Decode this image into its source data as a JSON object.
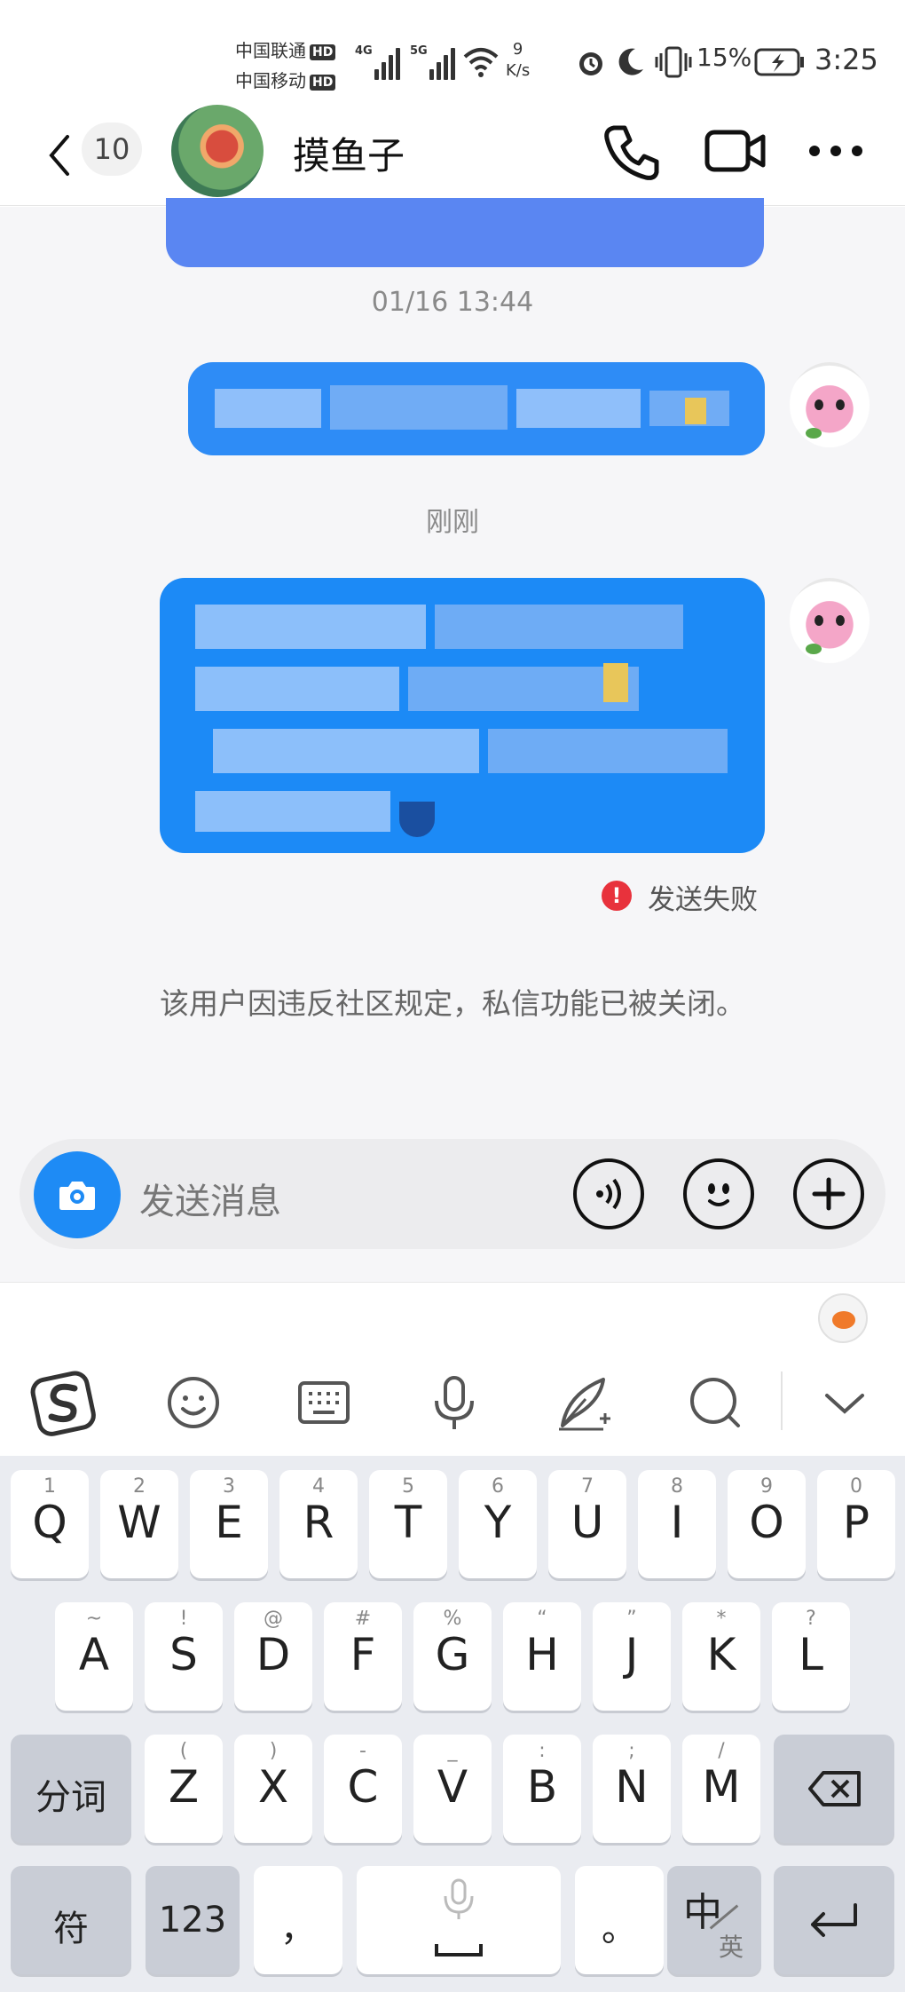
{
  "status_bar": {
    "carrier_1": "中国联通",
    "carrier_2": "中国移动",
    "hd_badge": "HD",
    "net_1": "4G",
    "net_2": "5G",
    "speed_value": "9",
    "speed_unit": "K/s",
    "battery": "15%",
    "time": "3:25"
  },
  "header": {
    "unread_count": "10",
    "contact_name": "摸鱼子"
  },
  "chat": {
    "timestamp_1": "01/16 13:44",
    "timestamp_2": "刚刚",
    "send_failed": "发送失败",
    "fail_icon": "!",
    "notice": "该用户因违反社区规定，私信功能已被关闭。"
  },
  "composer": {
    "placeholder": "发送消息"
  },
  "keyboard": {
    "row1": [
      {
        "key": "Q",
        "num": "1"
      },
      {
        "key": "W",
        "num": "2"
      },
      {
        "key": "E",
        "num": "3"
      },
      {
        "key": "R",
        "num": "4"
      },
      {
        "key": "T",
        "num": "5"
      },
      {
        "key": "Y",
        "num": "6"
      },
      {
        "key": "U",
        "num": "7"
      },
      {
        "key": "I",
        "num": "8"
      },
      {
        "key": "O",
        "num": "9"
      },
      {
        "key": "P",
        "num": "0"
      }
    ],
    "row2": [
      {
        "key": "A",
        "sym": "~"
      },
      {
        "key": "S",
        "sym": "!"
      },
      {
        "key": "D",
        "sym": "@"
      },
      {
        "key": "F",
        "sym": "#"
      },
      {
        "key": "G",
        "sym": "%"
      },
      {
        "key": "H",
        "sym": "“"
      },
      {
        "key": "J",
        "sym": "”"
      },
      {
        "key": "K",
        "sym": "*"
      },
      {
        "key": "L",
        "sym": "?"
      }
    ],
    "row3": [
      {
        "key": "Z",
        "sym": "("
      },
      {
        "key": "X",
        "sym": ")"
      },
      {
        "key": "C",
        "sym": "-"
      },
      {
        "key": "V",
        "sym": "_"
      },
      {
        "key": "B",
        "sym": ":"
      },
      {
        "key": "N",
        "sym": ";"
      },
      {
        "key": "M",
        "sym": "/"
      }
    ],
    "segment_key": "分词",
    "symbol_key": "符",
    "number_key": "123",
    "comma_key": "，",
    "period_key": "。",
    "lang_main": "中",
    "lang_sub": "英"
  },
  "colors": {
    "bubble_blue": "#1c8af6",
    "error_red": "#e8323c",
    "camera_blue": "#1e8bf5"
  }
}
